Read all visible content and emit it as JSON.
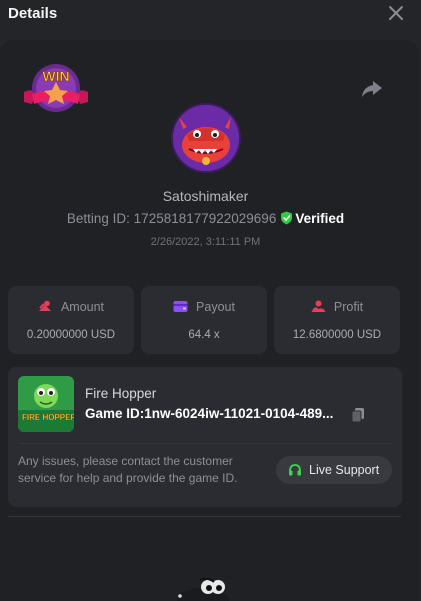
{
  "header": {
    "title": "Details",
    "close_icon": "close-icon"
  },
  "badge": {
    "text": "WIN",
    "icon": "win-badge-icon"
  },
  "share_icon": "share-icon",
  "player": {
    "username": "Satoshimaker",
    "betting_id_label": "Betting ID:",
    "betting_id": "1725818177922029696",
    "verified_label": "Verified",
    "date": "2/26/2022, 3:11:11 PM"
  },
  "stats": [
    {
      "label": "Amount",
      "value": "0.20000000 USD",
      "icon": "coins-icon"
    },
    {
      "label": "Payout",
      "value": "64.4 x",
      "icon": "wallet-icon"
    },
    {
      "label": "Profit",
      "value": "12.6800000 USD",
      "icon": "profit-icon"
    }
  ],
  "game": {
    "name": "Fire Hopper",
    "id_label": "Game ID:",
    "id": "1nw-6024iw-11021-0104-489...",
    "thumb_text": "FIRE HOPPER",
    "support_text": "Any issues, please contact the customer service for help and provide the game ID.",
    "support_button": "Live Support"
  },
  "colors": {
    "background": "#232529",
    "card": "#1f2124",
    "panel": "#2a2c31",
    "verified_green": "#2ecc40",
    "amount_icon": "#e63e5c",
    "payout_icon": "#8a4dff",
    "profit_icon": "#e63e5c",
    "support_icon": "#3dd64a"
  }
}
